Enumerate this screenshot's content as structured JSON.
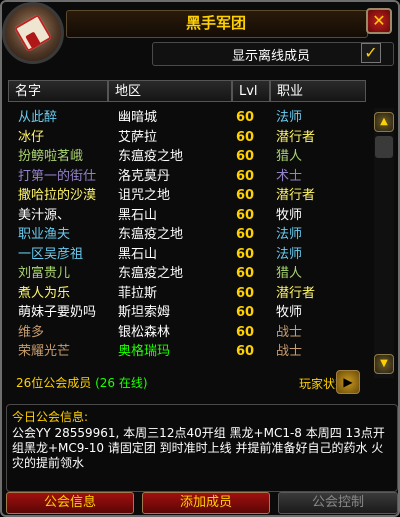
{
  "window": {
    "title": "黑手军团"
  },
  "filters": {
    "show_offline_label": "显示离线成员",
    "show_offline_checked": true
  },
  "columns": [
    "名字",
    "地区",
    "Lvl",
    "职业"
  ],
  "colors": {
    "gold": "#ffd100",
    "rogue": "#fff569",
    "mage": "#69ccf0",
    "warlock": "#9482c9",
    "hunter": "#abd473",
    "priest": "#ffffff",
    "warrior": "#c79c6e",
    "green": "#1eff00"
  },
  "roster": [
    {
      "name": "从此醉",
      "zone": "幽暗城",
      "level": "60",
      "class": "法师",
      "color": "#69ccf0"
    },
    {
      "name": "冰仔",
      "zone": "艾萨拉",
      "level": "60",
      "class": "潜行者",
      "color": "#fff569"
    },
    {
      "name": "扮鳑啦茗峨",
      "zone": "东瘟疫之地",
      "level": "60",
      "class": "猎人",
      "color": "#abd473"
    },
    {
      "name": "打第一的街仕",
      "zone": "洛克莫丹",
      "level": "60",
      "class": "术士",
      "color": "#9482c9"
    },
    {
      "name": "撒哈拉的沙漠",
      "zone": "诅咒之地",
      "level": "60",
      "class": "潜行者",
      "color": "#fff569"
    },
    {
      "name": "美汁源、",
      "zone": "黑石山",
      "level": "60",
      "class": "牧师",
      "color": "#ffffff"
    },
    {
      "name": "职业渔夫",
      "zone": "东瘟疫之地",
      "level": "60",
      "class": "法师",
      "color": "#69ccf0"
    },
    {
      "name": "一区吴彦祖",
      "zone": "黑石山",
      "level": "60",
      "class": "法师",
      "color": "#69ccf0"
    },
    {
      "name": "刘富贵儿",
      "zone": "东瘟疫之地",
      "level": "60",
      "class": "猎人",
      "color": "#abd473"
    },
    {
      "name": "煮人为乐",
      "zone": "菲拉斯",
      "level": "60",
      "class": "潜行者",
      "color": "#fff569"
    },
    {
      "name": "萌妹子要奶吗",
      "zone": "斯坦索姆",
      "level": "60",
      "class": "牧师",
      "color": "#ffffff"
    },
    {
      "name": "维多",
      "zone": "银松森林",
      "level": "60",
      "class": "战士",
      "color": "#c79c6e"
    },
    {
      "name": "荣耀光芒",
      "zone": "奥格瑞玛",
      "level": "60",
      "class": "战士",
      "color": "#c79c6e",
      "zone_color": "#1eff00"
    }
  ],
  "summary": {
    "members": "26位公会成员",
    "online": "(26 在线)",
    "player_status": "玩家状态"
  },
  "motd": {
    "title": "今日公会信息:",
    "text": "公会YY 28559961, 本周三12点40开组 黑龙+MC1-8 本周四 13点开组黑龙+MC9-10 请固定团 到时准时上线 并提前准备好自己的药水 火灾的提前领水"
  },
  "buttons": {
    "guild_info": "公会信息",
    "add_member": "添加成员",
    "guild_control": "公会控制"
  }
}
